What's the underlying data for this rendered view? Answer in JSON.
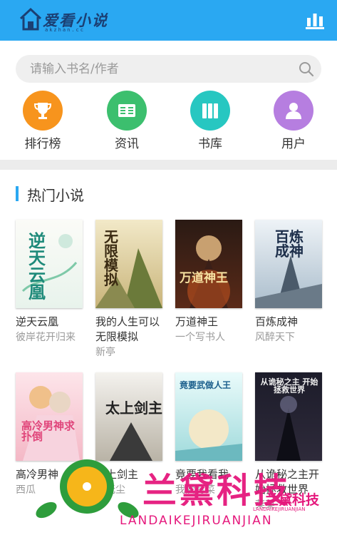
{
  "header": {
    "logo_text": "爱看小说",
    "logo_sub": "akzhan.cc",
    "rank_icon": "bar-chart-icon",
    "color": "#2aa8f2"
  },
  "search": {
    "placeholder": "请输入书名/作者"
  },
  "nav": [
    {
      "label": "排行榜",
      "icon": "trophy-icon",
      "color": "#f7941d"
    },
    {
      "label": "资讯",
      "icon": "news-icon",
      "color": "#3cbf6e"
    },
    {
      "label": "书库",
      "icon": "books-icon",
      "color": "#27c7c1"
    },
    {
      "label": "用户",
      "icon": "user-icon",
      "color": "#b67ee0"
    }
  ],
  "hot": {
    "title": "热门小说",
    "books": [
      {
        "name": "逆天云凰",
        "author": "彼岸花开归来",
        "cover_title": "逆天云凰"
      },
      {
        "name": "我的人生可以无限模拟",
        "author": "新亭",
        "cover_title": "无限模拟"
      },
      {
        "name": "万道神王",
        "author": "一个写书人",
        "cover_title": "万道神王"
      },
      {
        "name": "百炼成神",
        "author": "风醉天下",
        "cover_title": "百炼成神"
      },
      {
        "name": "高冷男神",
        "author": "西瓜",
        "cover_title": "高冷男神求扑倒"
      },
      {
        "name": "太上剑主",
        "author": "月无尘",
        "cover_title": "太上剑主"
      },
      {
        "name": "竟要我看我",
        "author": "我爱有菜",
        "cover_title": "竟要武做人王"
      },
      {
        "name": "从诡秘之主开始拯救世界",
        "author": "菜菜",
        "cover_title": "从诡秘之主 开始拯救世界"
      }
    ]
  },
  "watermark": {
    "text": "兰黛科技",
    "sub": "LANDAIKEJIRUANJIAN",
    "text2": "兰黛科技",
    "sub2": "LANDAIKEJIRUANJIAN"
  }
}
